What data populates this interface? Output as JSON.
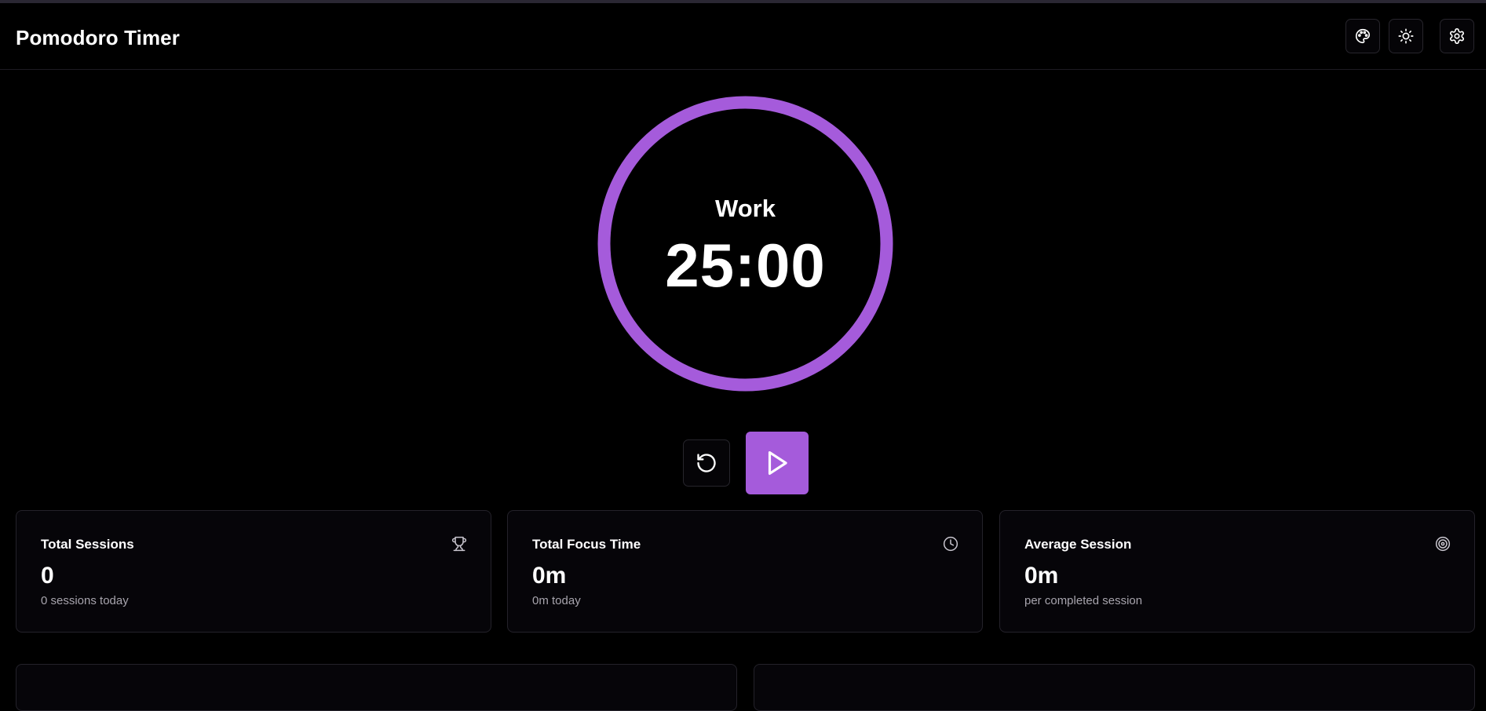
{
  "header": {
    "title": "Pomodoro Timer",
    "buttons": [
      {
        "icon": "palette-icon"
      },
      {
        "icon": "sun-icon"
      },
      {
        "icon": "gear-icon"
      }
    ]
  },
  "timer": {
    "mode": "Work",
    "time": "25:00",
    "progress": 1.0
  },
  "controls": {
    "reset_icon": "rotate-ccw-icon",
    "play_icon": "play-icon"
  },
  "stats": [
    {
      "title": "Total Sessions",
      "value": "0",
      "sub": "0 sessions today",
      "icon": "trophy-icon"
    },
    {
      "title": "Total Focus Time",
      "value": "0m",
      "sub": "0m today",
      "icon": "clock-icon"
    },
    {
      "title": "Average Session",
      "value": "0m",
      "sub": "per completed session",
      "icon": "target-icon"
    }
  ],
  "colors": {
    "accent": "#a55bdb",
    "background": "#000000",
    "card_background": "#060509",
    "card_border": "#24222a",
    "muted_text": "#a7a4ad"
  }
}
